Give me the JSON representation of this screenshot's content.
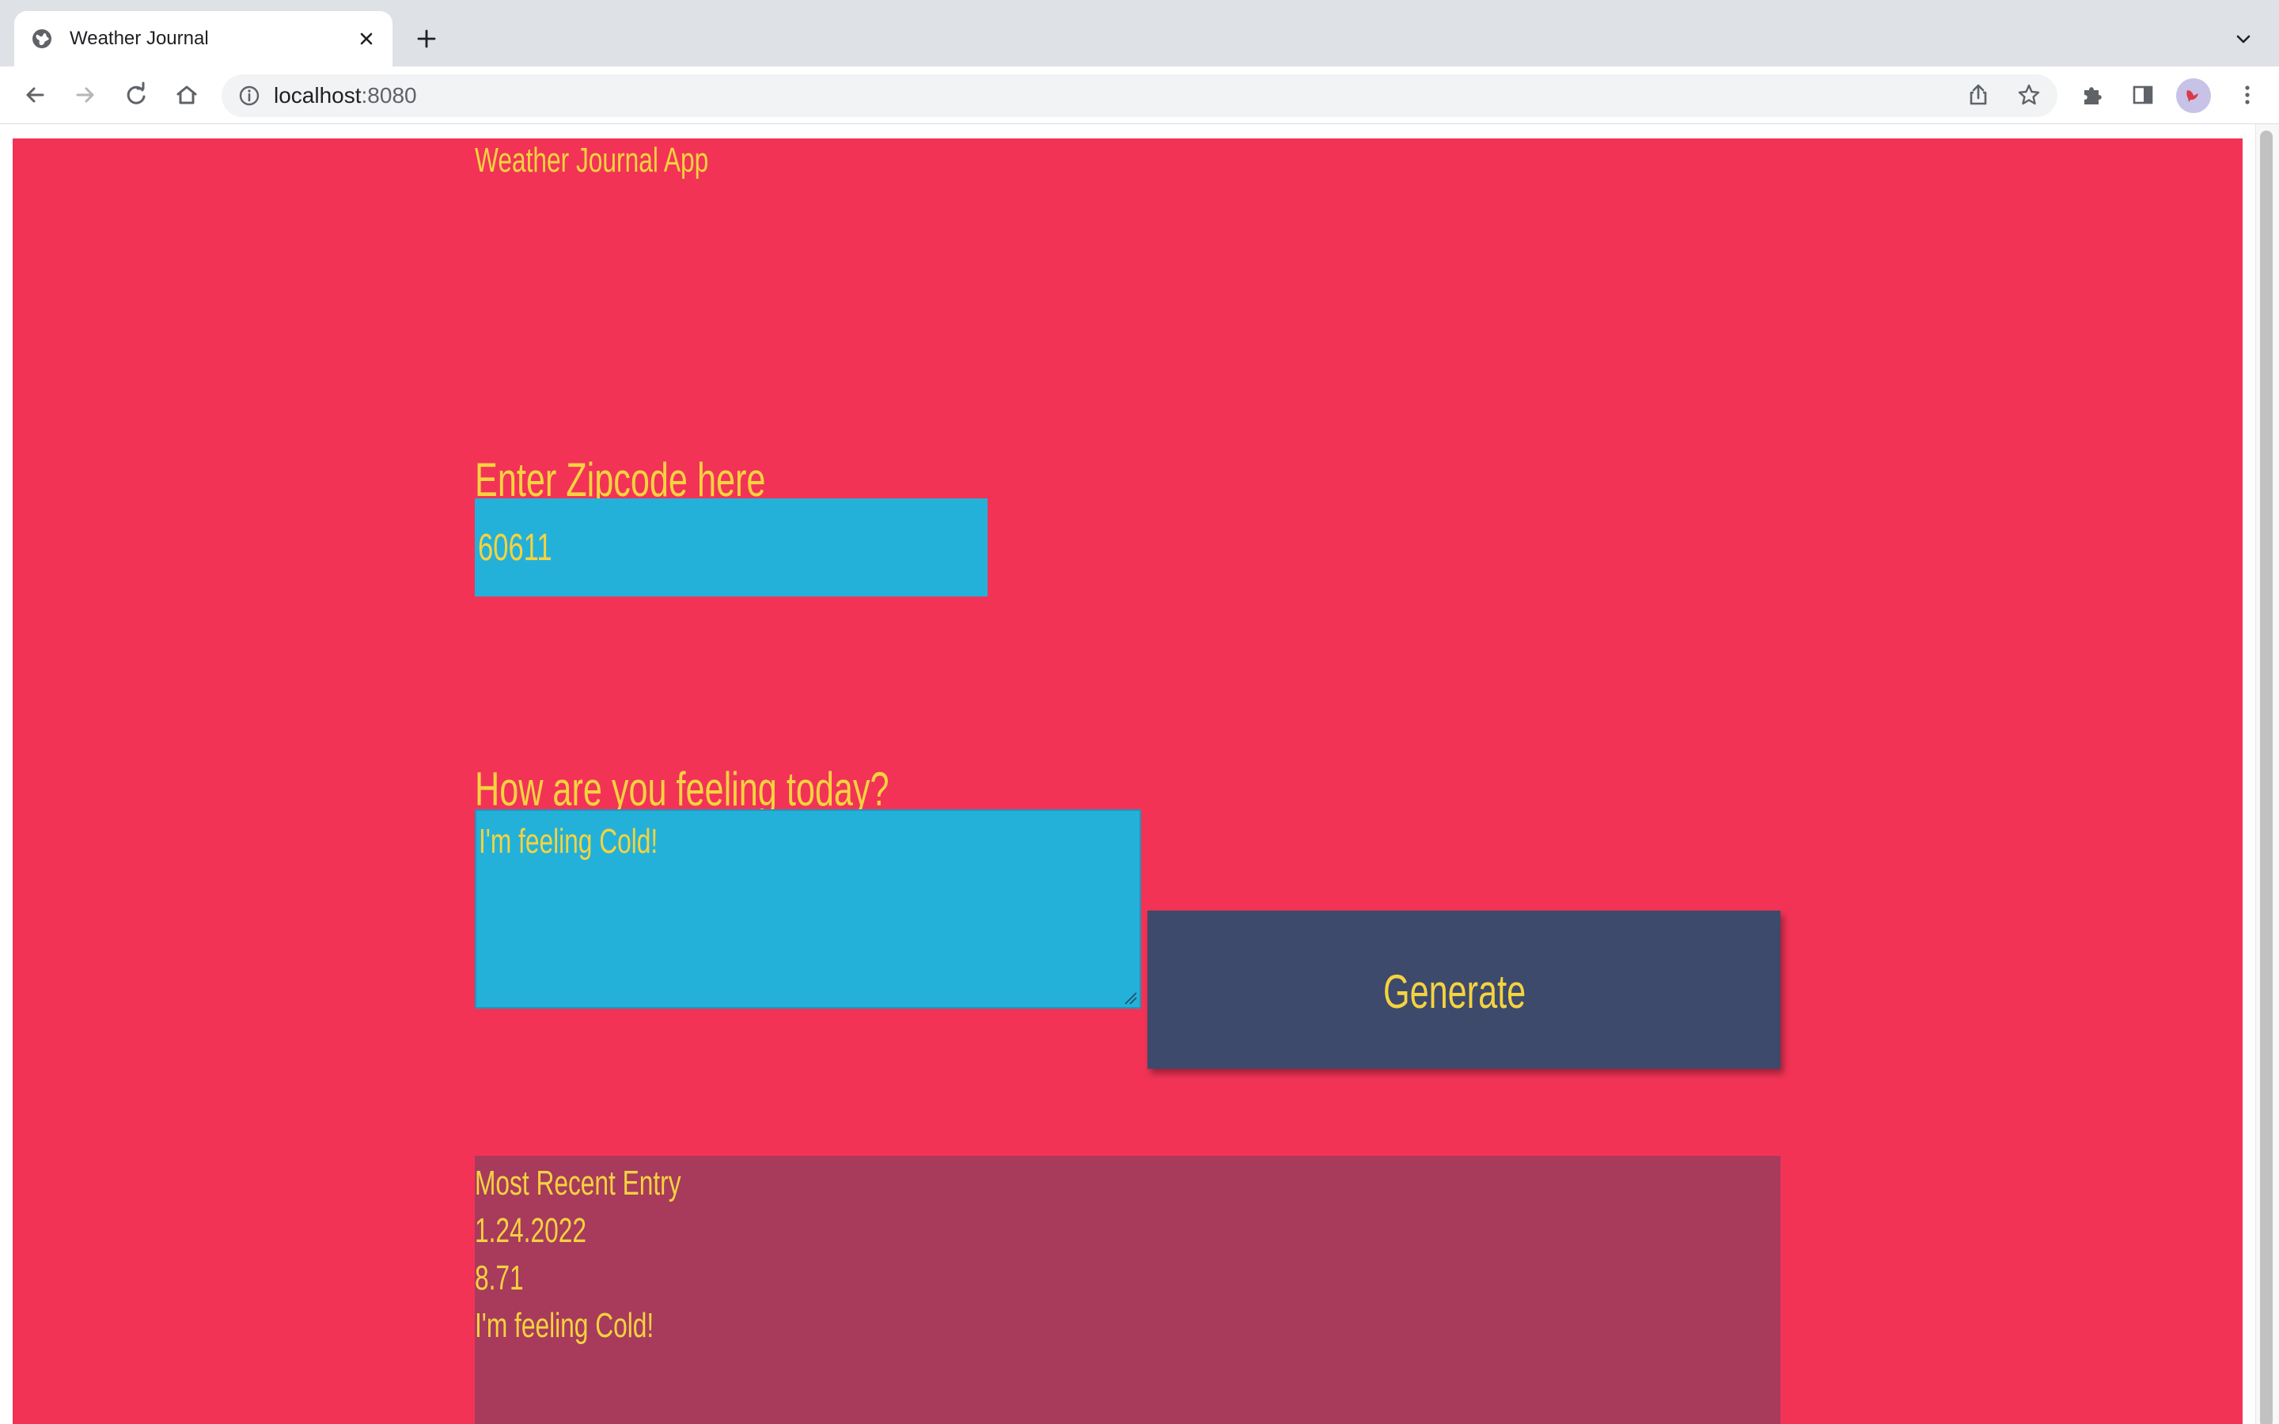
{
  "browser": {
    "tab": {
      "title": "Weather Journal"
    },
    "address": {
      "host": "localhost",
      "port": ":8080"
    }
  },
  "page": {
    "app_title": "Weather Journal App",
    "zip": {
      "label": "Enter Zipcode here",
      "value": "60611"
    },
    "feelings": {
      "label": "How are you feeling today?",
      "value": "I'm feeling Cold!"
    },
    "generate_label": "Generate",
    "entry": {
      "heading": "Most Recent Entry",
      "date": "1.24.2022",
      "temp": "8.71",
      "content": "I'm feeling Cold!"
    }
  },
  "colors": {
    "page_background": "#f23356",
    "text": "#f5d33f",
    "input_background": "#23b1da",
    "button_background": "#3d4a6c",
    "entry_background": "#a83a5c"
  }
}
